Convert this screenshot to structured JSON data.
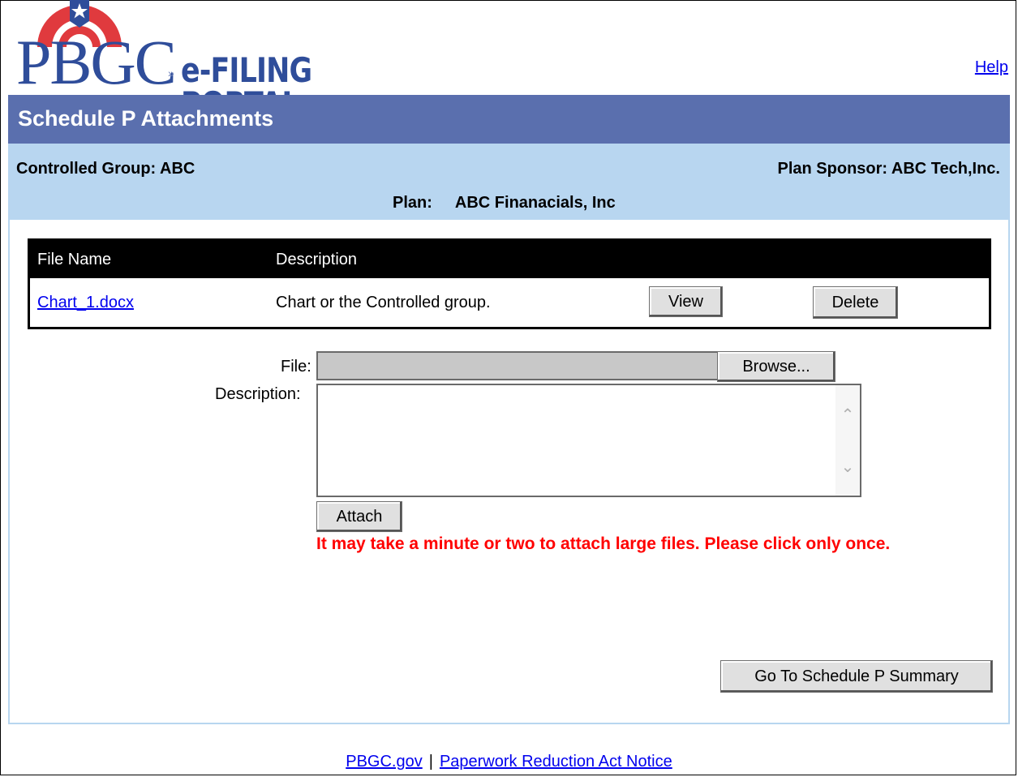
{
  "header": {
    "logo_pbgc": "PBGC",
    "logo_separator": "»",
    "logo_efiling": "e-FILING PORTAL",
    "help_link": "Help"
  },
  "page": {
    "title": "Schedule P Attachments"
  },
  "info": {
    "controlled_group": "Controlled Group: ABC",
    "plan_sponsor": "Plan Sponsor:  ABC Tech,Inc.",
    "plan_label": "Plan:",
    "plan_value": "ABC Finanacials, Inc"
  },
  "files_table": {
    "columns": [
      "File Name",
      "Description"
    ],
    "rows": [
      {
        "file_name": "Chart_1.docx",
        "description": "Chart or the Controlled group.",
        "view_label": "View",
        "delete_label": "Delete"
      }
    ]
  },
  "upload_form": {
    "file_label": "File:",
    "file_value": "",
    "browse_label": "Browse...",
    "description_label": "Description:",
    "description_value": "",
    "attach_label": "Attach",
    "warning": "It may take a minute or two to attach large files.  Please click only once."
  },
  "actions": {
    "summary_label": "Go To Schedule P Summary"
  },
  "footer": {
    "link_pbgc": "PBGC.gov",
    "separator": "|",
    "link_paperwork": "Paperwork Reduction Act Notice"
  },
  "colors": {
    "title_bar": "#5a6fae",
    "info_band": "#b8d6f0",
    "warning_text": "#ff0000",
    "logo_blue": "#2f4d9a",
    "logo_red": "#e03a3e"
  },
  "icons": {
    "scroll_up": "chevron-up-icon",
    "scroll_down": "chevron-down-icon",
    "logo_star": "star-icon"
  }
}
